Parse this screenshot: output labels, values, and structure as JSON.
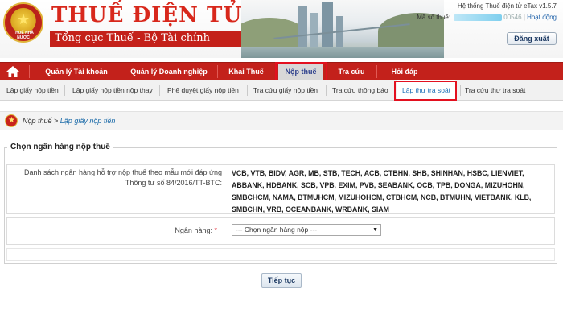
{
  "header": {
    "brand_title": "THUẾ ĐIỆN TỬ",
    "brand_subtitle": "Tổng cục Thuế - Bộ Tài chính",
    "emblem_text": "THUẾ NHÀ NƯỚC",
    "system_name": "Hệ thống Thuế điện tử eTax v1.5.7",
    "tax_id_label": "Mã số thuế:",
    "tax_id_value": "00546",
    "activity_link": "Hoạt động",
    "logout_label": "Đăng xuất"
  },
  "navbar": {
    "items": [
      {
        "label": "Quản lý Tài khoản"
      },
      {
        "label": "Quản lý Doanh nghiệp"
      },
      {
        "label": "Khai Thuế"
      },
      {
        "label": "Nộp thuế"
      },
      {
        "label": "Tra cứu"
      },
      {
        "label": "Hỏi đáp"
      }
    ],
    "active_index": 3,
    "bar_color": "#c3211b"
  },
  "subnav": {
    "items": [
      {
        "label": "Lập giấy nộp tiền"
      },
      {
        "label": "Lập giấy nộp tiền nộp thay"
      },
      {
        "label": "Phê duyệt giấy nộp tiền"
      },
      {
        "label": "Tra cứu giấy nộp tiền"
      },
      {
        "label": "Tra cứu thông báo"
      },
      {
        "label": "Lập thư tra soát"
      },
      {
        "label": "Tra cứu thư tra soát"
      }
    ],
    "active_index": 5
  },
  "breadcrumb": {
    "parent": "Nộp thuế",
    "separator": " > ",
    "current": "Lập giấy nộp tiền"
  },
  "panel": {
    "legend": "Chọn ngân hàng nộp thuế",
    "banks_label": "Danh sách ngân hàng hỗ trợ nộp thuế theo mẫu mới đáp ứng Thông tư số 84/2016/TT-BTC:",
    "banks_list": "VCB, VTB, BIDV, AGR, MB, STB, TECH, ACB, CTBHN, SHB, SHINHAN, HSBC, LIENVIET, ABBANK, HDBANK, SCB, VPB, EXIM, PVB, SEABANK, OCB, TPB, DONGA, MIZUHOHN, SMBCHCM, NAMA, BTMUHCM, MIZUHOHCM, CTBHCM, NCB, BTMUHN, VIETBANK, KLB, SMBCHN, VRB, OCEANBANK, WRBANK, SIAM",
    "bank_label": "Ngân hàng:",
    "required_mark": "*",
    "bank_select_value": "--- Chọn ngân hàng nộp ---"
  },
  "actions": {
    "continue_label": "Tiếp tục"
  },
  "icons": {
    "home": "home-icon",
    "emblem": "national-emblem-icon",
    "dropdown": "chevron-down-icon"
  },
  "colors": {
    "brand_red": "#c3211b",
    "highlight_red": "#e3101f",
    "link_blue": "#1a6aa8"
  }
}
